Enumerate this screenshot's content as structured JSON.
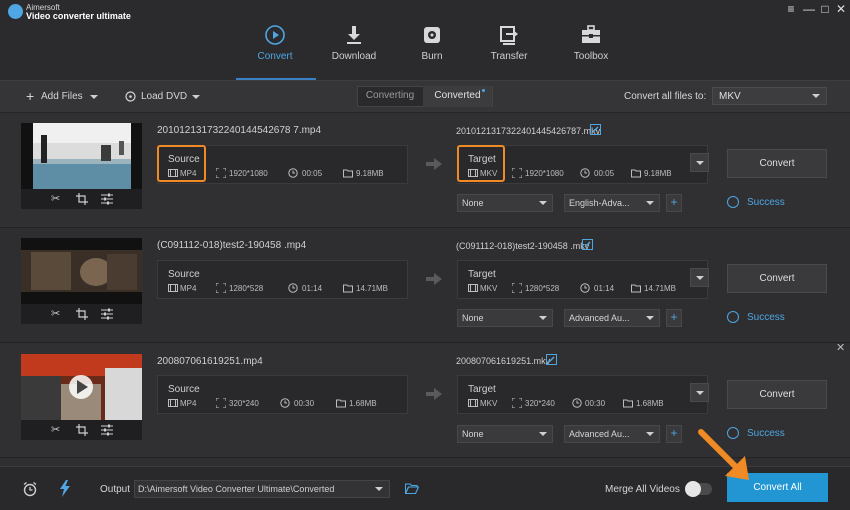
{
  "app": {
    "brand_small": "Aimersoft",
    "brand_name": "Video converter ultimate"
  },
  "window_controls": [
    "≡",
    "—",
    "□",
    "✕"
  ],
  "nav": [
    {
      "label": "Convert",
      "icon": "convert-icon",
      "active": true
    },
    {
      "label": "Download",
      "icon": "download-icon"
    },
    {
      "label": "Burn",
      "icon": "burn-disc-icon"
    },
    {
      "label": "Transfer",
      "icon": "transfer-icon"
    },
    {
      "label": "Toolbox",
      "icon": "toolbox-icon"
    }
  ],
  "toolbar": {
    "add_files": "Add Files",
    "load_dvd": "Load DVD",
    "tab_converting": "Converting",
    "tab_converted": "Converted",
    "convert_all_to_label": "Convert all files to:",
    "convert_all_to_value": "MKV"
  },
  "files": [
    {
      "name": "201012131732240144542678 7.mp4",
      "target_name": "2010121317322401445426787.mkv",
      "source": {
        "label": "Source",
        "format": "MP4",
        "resolution": "1920*1080",
        "duration": "00:05",
        "size": "9.18MB"
      },
      "target": {
        "label": "Target",
        "format": "MKV",
        "resolution": "1920*1080",
        "duration": "00:05",
        "size": "9.18MB"
      },
      "subtitle": "None",
      "audio": "English-Adva...",
      "convert": "Convert",
      "status": "Success"
    },
    {
      "name": "(C091112-018)test2-190458 .mp4",
      "target_name": "(C091112-018)test2-190458 .mkv",
      "source": {
        "label": "Source",
        "format": "MP4",
        "resolution": "1280*528",
        "duration": "01:14",
        "size": "14.71MB"
      },
      "target": {
        "label": "Target",
        "format": "MKV",
        "resolution": "1280*528",
        "duration": "01:14",
        "size": "14.71MB"
      },
      "subtitle": "None",
      "audio": "Advanced Au...",
      "convert": "Convert",
      "status": "Success"
    },
    {
      "name": "200807061619251.mp4",
      "target_name": "200807061619251.mkv",
      "source": {
        "label": "Source",
        "format": "MP4",
        "resolution": "320*240",
        "duration": "00:30",
        "size": "1.68MB"
      },
      "target": {
        "label": "Target",
        "format": "MKV",
        "resolution": "320*240",
        "duration": "00:30",
        "size": "1.68MB"
      },
      "subtitle": "None",
      "audio": "Advanced Au...",
      "convert": "Convert",
      "status": "Success"
    }
  ],
  "bottom": {
    "output_label": "Output",
    "output_path": "D:\\Aimersoft Video Converter Ultimate\\Converted",
    "merge_label": "Merge All Videos",
    "convert_all": "Convert All"
  },
  "colors": {
    "accent": "#2196d3",
    "highlight": "#f08a24",
    "success": "#4ea6e3"
  }
}
